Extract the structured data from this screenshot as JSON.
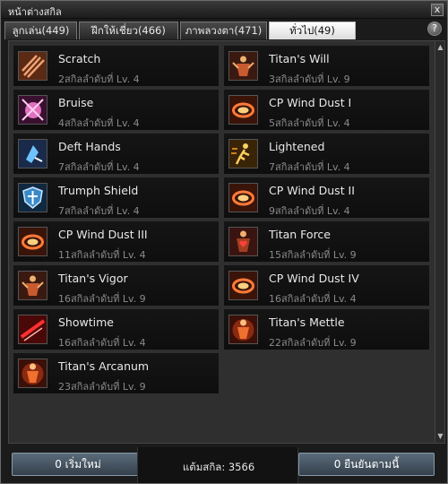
{
  "window": {
    "title": "หน้าต่างสกิล",
    "close_glyph": "x",
    "help_glyph": "?"
  },
  "tabs": [
    {
      "label": "ลูกเล่น(449)"
    },
    {
      "label": "ฝึกให้เชี่ยว(466)"
    },
    {
      "label": "ภาพลวงตา(471)"
    },
    {
      "label": "ทั่วไป(49)",
      "active": true
    }
  ],
  "skills_left": [
    {
      "name": "Scratch",
      "sub": "2สกิลลำดับที่ Lv. 4",
      "icon": "claw-scratch-icon"
    },
    {
      "name": "Bruise",
      "sub": "4สกิลลำดับที่ Lv. 4",
      "icon": "pink-burst-icon"
    },
    {
      "name": "Deft Hands",
      "sub": "7สกิลลำดับที่ Lv. 4",
      "icon": "hands-shape-icon"
    },
    {
      "name": "Trumph Shield",
      "sub": "7สกิลลำดับที่ Lv. 4",
      "icon": "shield-icon"
    },
    {
      "name": "CP Wind Dust III",
      "sub": "11สกิลลำดับที่ Lv. 4",
      "icon": "wind-ring-icon"
    },
    {
      "name": "Titan's Vigor",
      "sub": "16สกิลลำดับที่ Lv. 9",
      "icon": "titan-figure-icon"
    },
    {
      "name": "Showtime",
      "sub": "16สกิลลำดับที่ Lv. 4",
      "icon": "red-slash-icon"
    },
    {
      "name": "Titan's Arcanum",
      "sub": "23สกิลลำดับที่ Lv. 9",
      "icon": "titan-aura-icon"
    }
  ],
  "skills_right": [
    {
      "name": "Titan's Will",
      "sub": "3สกิลลำดับที่ Lv. 9",
      "icon": "titan-figure-icon"
    },
    {
      "name": "CP Wind Dust I",
      "sub": "5สกิลลำดับที่ Lv. 4",
      "icon": "wind-ring-icon"
    },
    {
      "name": "Lightened",
      "sub": "7สกิลลำดับที่ Lv. 4",
      "icon": "running-figure-icon"
    },
    {
      "name": "CP Wind Dust II",
      "sub": "9สกิลลำดับที่ Lv. 4",
      "icon": "wind-ring-icon"
    },
    {
      "name": "Titan Force",
      "sub": "15สกิลลำดับที่ Lv. 9",
      "icon": "titan-heart-icon"
    },
    {
      "name": "CP Wind Dust IV",
      "sub": "16สกิลลำดับที่ Lv. 4",
      "icon": "wind-ring-icon"
    },
    {
      "name": "Titan's Mettle",
      "sub": "22สกิลลำดับที่ Lv. 9",
      "icon": "titan-aura-icon"
    }
  ],
  "footer": {
    "reset_label": "0 เริ่มใหม่",
    "points_label": "แต้มสกิล: 3566",
    "confirm_label": "0 ยืนยันตามนี้"
  },
  "colors": {
    "accent_tab": "#ffffff",
    "button": "#4a5a68",
    "slot": "#121212"
  }
}
